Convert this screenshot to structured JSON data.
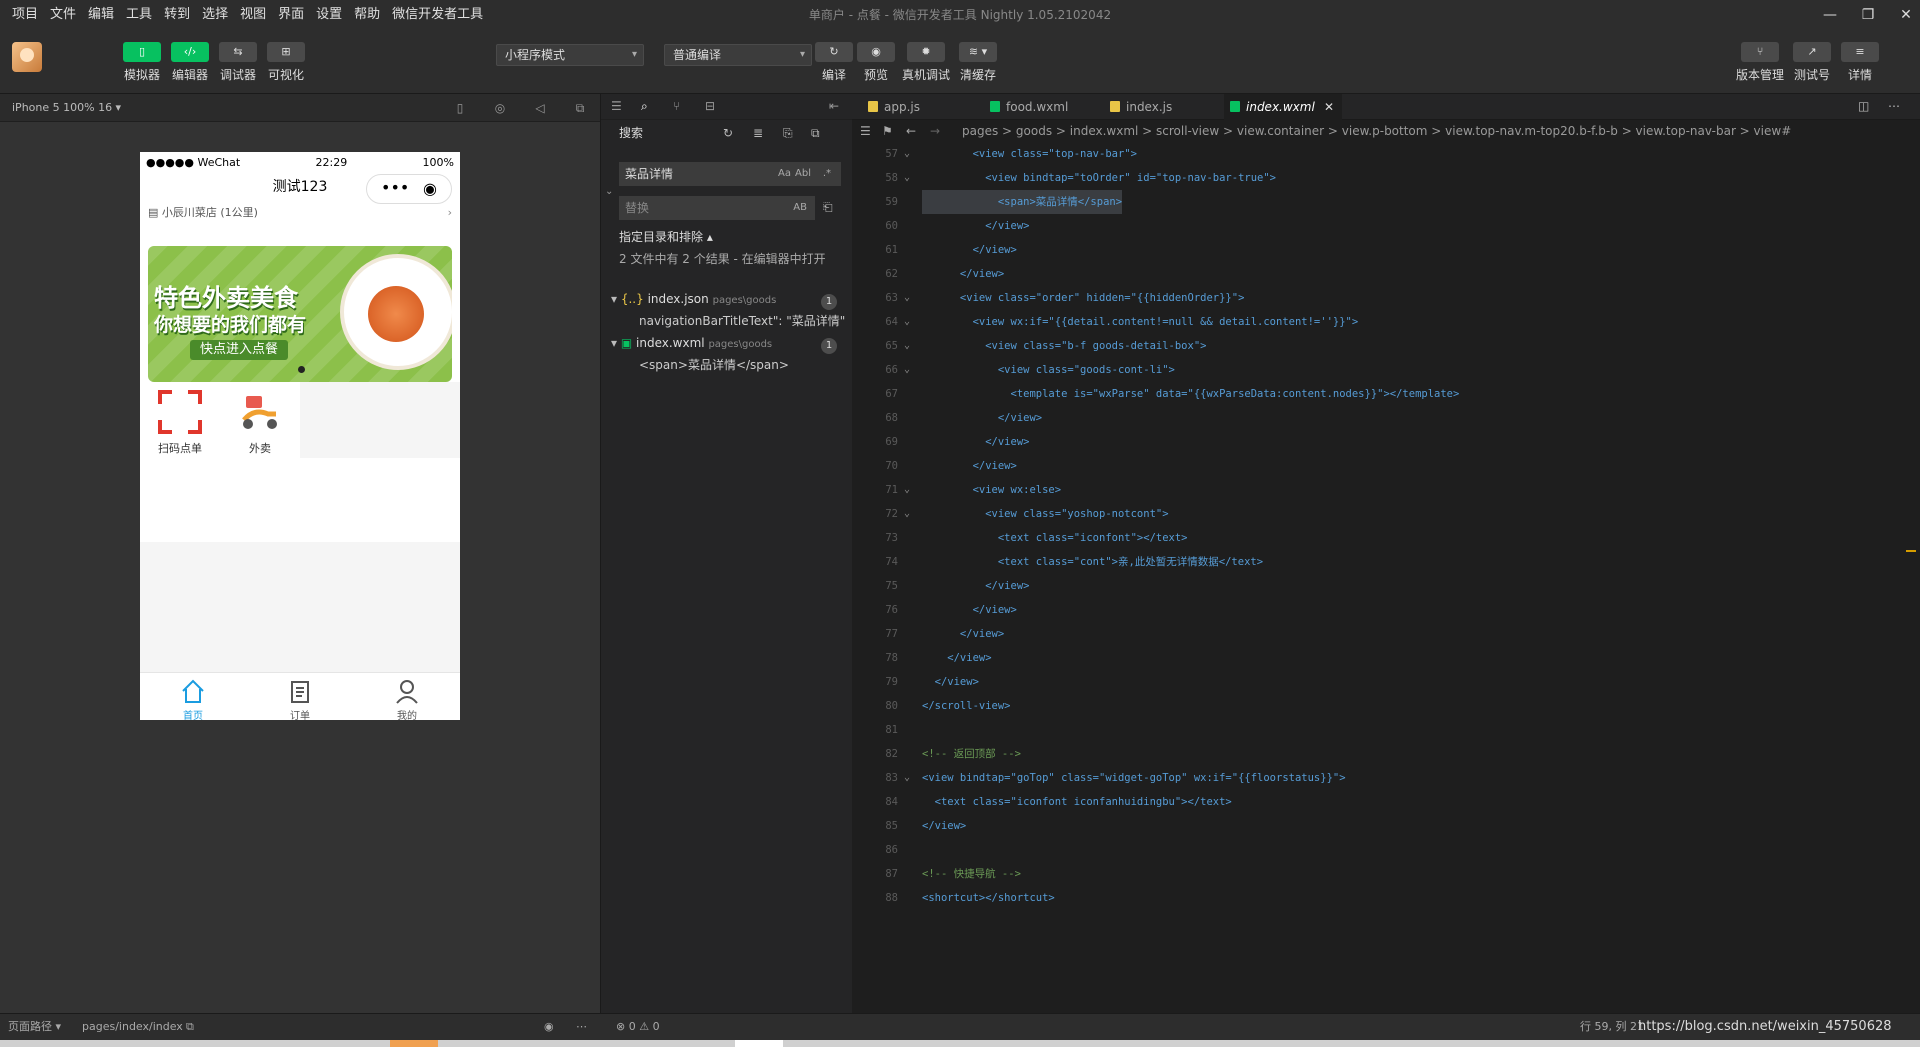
{
  "menu": [
    "项目",
    "文件",
    "编辑",
    "工具",
    "转到",
    "选择",
    "视图",
    "界面",
    "设置",
    "帮助",
    "微信开发者工具"
  ],
  "window_title": "单商户 - 点餐 - 微信开发者工具 Nightly 1.05.2102042",
  "toolbar": {
    "simulator": "模拟器",
    "editor": "编辑器",
    "debugger": "调试器",
    "visual": "可视化",
    "mode_select": "小程序模式",
    "compile_select": "普通编译",
    "compile": "编译",
    "preview": "预览",
    "remote_debug": "真机调试",
    "clear_cache": "清缓存",
    "version": "版本管理",
    "test": "测试号",
    "details": "详情"
  },
  "simulator": {
    "device": "iPhone 5 100% 16 ▾",
    "status_carrier": "●●●●● WeChat",
    "status_time": "22:29",
    "status_battery": "100%",
    "nav_title": "测试123",
    "store": "小辰川菜店 (1公里)",
    "banner_line1": "特色外卖美食",
    "banner_line2": "你想要的我们都有",
    "banner_button": "快点进入点餐",
    "grid": [
      "扫码点单",
      "外卖"
    ],
    "tabs": [
      "首页",
      "订单",
      "我的"
    ]
  },
  "search": {
    "title": "搜索",
    "query": "菜品详情",
    "replace_placeholder": "替换",
    "case_label": "Aa",
    "word_label": "Abl",
    "regex_label": ".*",
    "preserve_label": "AB",
    "include_exclude": "指定目录和排除 ▴",
    "summary": "2 文件中有 2 个结果 - 在编辑器中打开",
    "results": [
      {
        "file": "index.json",
        "path": "pages\\goods",
        "count": "1",
        "match": "navigationBarTitleText\": \"菜品详情\","
      },
      {
        "file": "index.wxml",
        "path": "pages\\goods",
        "count": "1",
        "match": "<span>菜品详情</span>"
      }
    ]
  },
  "editor": {
    "tabs": [
      "app.js",
      "food.wxml",
      "index.js",
      "index.wxml"
    ],
    "breadcrumb": "pages > goods > index.wxml > scroll-view > view.container > view.p-bottom > view.top-nav.m-top20.b-f.b-b > view.top-nav-bar > view#",
    "lines": [
      {
        "n": "57",
        "t": "        <view class=\"top-nav-bar\">"
      },
      {
        "n": "58",
        "t": "          <view bindtap=\"toOrder\" id=\"top-nav-bar-true\">"
      },
      {
        "n": "59",
        "t": "            <span>菜品详情</span>"
      },
      {
        "n": "60",
        "t": "          </view>"
      },
      {
        "n": "61",
        "t": "        </view>"
      },
      {
        "n": "62",
        "t": "      </view>"
      },
      {
        "n": "63",
        "t": "      <view class=\"order\" hidden=\"{{hiddenOrder}}\">"
      },
      {
        "n": "64",
        "t": "        <view wx:if=\"{{detail.content!=null && detail.content!=''}}\">"
      },
      {
        "n": "65",
        "t": "          <view class=\"b-f goods-detail-box\">"
      },
      {
        "n": "66",
        "t": "            <view class=\"goods-cont-li\">"
      },
      {
        "n": "67",
        "t": "              <template is=\"wxParse\" data=\"{{wxParseData:content.nodes}}\"></template>"
      },
      {
        "n": "68",
        "t": "            </view>"
      },
      {
        "n": "69",
        "t": "          </view>"
      },
      {
        "n": "70",
        "t": "        </view>"
      },
      {
        "n": "71",
        "t": "        <view wx:else>"
      },
      {
        "n": "72",
        "t": "          <view class=\"yoshop-notcont\">"
      },
      {
        "n": "73",
        "t": "            <text class=\"iconfont\"></text>"
      },
      {
        "n": "74",
        "t": "            <text class=\"cont\">亲,此处暂无详情数据</text>"
      },
      {
        "n": "75",
        "t": "          </view>"
      },
      {
        "n": "76",
        "t": "        </view>"
      },
      {
        "n": "77",
        "t": "      </view>"
      },
      {
        "n": "78",
        "t": "    </view>"
      },
      {
        "n": "79",
        "t": "  </view>"
      },
      {
        "n": "80",
        "t": "</scroll-view>"
      },
      {
        "n": "81",
        "t": ""
      },
      {
        "n": "82",
        "t": "<!-- 返回顶部 -->"
      },
      {
        "n": "83",
        "t": "<view bindtap=\"goTop\" class=\"widget-goTop\" wx:if=\"{{floorstatus}}\">"
      },
      {
        "n": "84",
        "t": "  <text class=\"iconfont iconfanhuidingbu\"></text>"
      },
      {
        "n": "85",
        "t": "</view>"
      },
      {
        "n": "86",
        "t": ""
      },
      {
        "n": "87",
        "t": "<!-- 快捷导航 -->"
      },
      {
        "n": "88",
        "t": "<shortcut></shortcut>"
      }
    ]
  },
  "status": {
    "page_path_label": "页面路径 ▾",
    "page_path": "pages/index/index",
    "problems": "⊗ 0 ⚠ 0",
    "cursor": "行 59, 列 21",
    "watermark": "https://blog.csdn.net/weixin_45750628"
  },
  "colors": {
    "accent": "#07c160",
    "tab_active": "#1a9ce0",
    "banner": "#8cc04a"
  }
}
